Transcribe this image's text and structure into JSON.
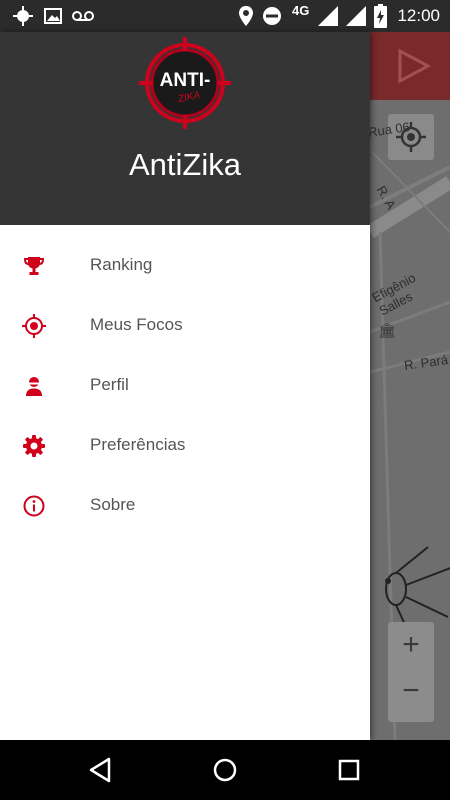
{
  "status_bar": {
    "network": "4G",
    "time": "12:00",
    "icons": [
      "gps-icon",
      "image-icon",
      "voicemail-icon",
      "location-icon",
      "dnd-icon",
      "signal-icon",
      "charging-battery-icon"
    ]
  },
  "drawer": {
    "app_title": "AntiZika",
    "logo": {
      "top_text": "ANTI-",
      "bottom_text": "ZIKA",
      "accent": "#d0021b"
    },
    "items": [
      {
        "label": "Ranking",
        "icon": "trophy-icon"
      },
      {
        "label": "Meus Focos",
        "icon": "target-icon"
      },
      {
        "label": "Perfil",
        "icon": "person-icon"
      },
      {
        "label": "Preferências",
        "icon": "gear-icon"
      },
      {
        "label": "Sobre",
        "icon": "info-icon"
      }
    ]
  },
  "map": {
    "labels": [
      "Rua 06",
      "R. A",
      "Efigênio Salles",
      "R. Pará"
    ],
    "zoom_in": "+",
    "zoom_out": "−"
  },
  "colors": {
    "accent": "#d0021b",
    "header_bg": "#353535",
    "status_bar_bg": "#2b2b2b"
  }
}
